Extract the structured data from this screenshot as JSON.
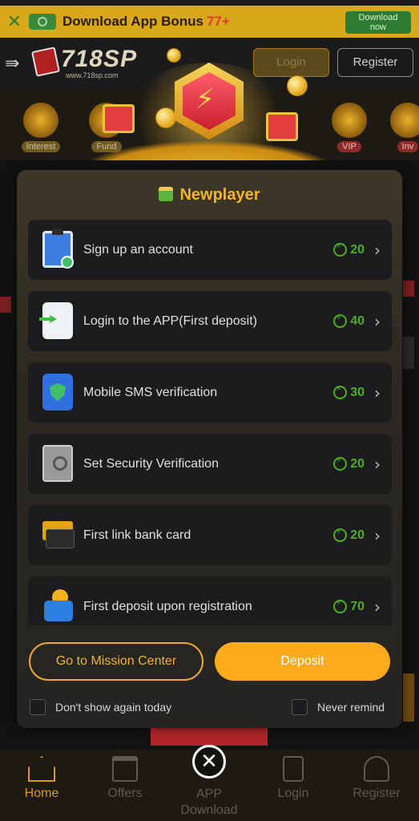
{
  "banner": {
    "title": "Download App Bonus",
    "bonus": "77+",
    "download_label_line1": "Download",
    "download_label_line2": "now",
    "close_glyph": "✕"
  },
  "header": {
    "brand": "718SP",
    "brand_url": "www.718sp.com",
    "login_label": "Login",
    "register_label": "Register",
    "menu_glyph": "⇛"
  },
  "shortcuts": [
    {
      "label": "Interest"
    },
    {
      "label": "Fund"
    },
    {
      "label": "VIP"
    },
    {
      "label": "Inv"
    }
  ],
  "modal": {
    "title": "Newplayer",
    "tasks": [
      {
        "icon": "clipboard-check-icon",
        "label": "Sign up an account",
        "reward": "20"
      },
      {
        "icon": "phone-login-icon",
        "label": "Login to the APP(First deposit)",
        "reward": "40"
      },
      {
        "icon": "phone-shield-icon",
        "label": "Mobile SMS verification",
        "reward": "30"
      },
      {
        "icon": "safe-icon",
        "label": "Set Security Verification",
        "reward": "20"
      },
      {
        "icon": "bank-card-icon",
        "label": "First link bank card",
        "reward": "20"
      },
      {
        "icon": "wallet-coin-icon",
        "label": "First deposit upon registration",
        "reward": "70"
      }
    ],
    "mission_button": "Go to Mission Center",
    "deposit_button": "Deposit",
    "dont_show_today": "Don't show again today",
    "never_remind": "Never remind",
    "chevron_glyph": "›",
    "close_glyph": "✕"
  },
  "bottom_nav": {
    "items": [
      {
        "label": "Home",
        "active": true
      },
      {
        "label": "Offers",
        "active": false
      },
      {
        "label": "APP",
        "label2": "Download",
        "active": false
      },
      {
        "label": "Login",
        "active": false
      },
      {
        "label": "Register",
        "active": false
      }
    ]
  },
  "colors": {
    "accent": "#fbab1b",
    "reward_green": "#4caf1e",
    "banner_bg": "#d9a81a",
    "modal_title": "#f3b42a"
  }
}
